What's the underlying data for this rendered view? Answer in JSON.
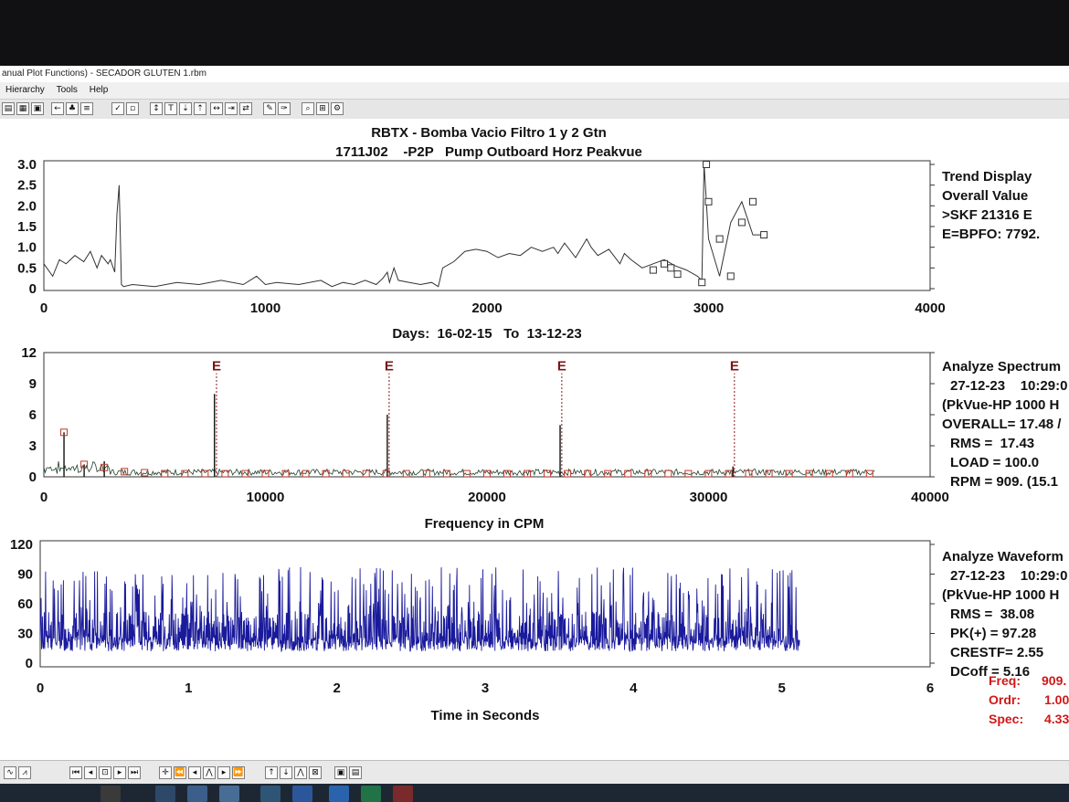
{
  "window": {
    "title": "anual Plot Functions) - SECADOR GLUTEN 1.rbm",
    "menu": [
      "Hierarchy",
      "Tools",
      "Help"
    ]
  },
  "header": {
    "title": "RBTX - Bomba Vacio Filtro 1 y 2 Gtn",
    "subtitle": "1711J02    -P2P   Pump Outboard Horz Peakvue"
  },
  "trend": {
    "info": [
      "Trend Display",
      "Overall Value",
      ">SKF 21316 E",
      "E=BPFO: 7792."
    ],
    "xlabel": "Days:  16-02-15   To  13-12-23"
  },
  "spectrum": {
    "marker_label": "E",
    "info": [
      "Analyze Spectrum",
      "27-12-23    10:29:0",
      "(PkVue-HP 1000 H",
      "OVERALL= 17.48 /",
      "RMS =  17.43",
      "LOAD = 100.0",
      "RPM = 909. (15.1"
    ],
    "xlabel": "Frequency in CPM"
  },
  "waveform": {
    "info": [
      "Analyze Waveform",
      "27-12-23    10:29:0",
      "(PkVue-HP 1000 H",
      "RMS =  38.08",
      "PK(+) = 97.28",
      "CRESTF= 2.55",
      "DCoff = 5.16"
    ],
    "xlabel": "Time in Seconds"
  },
  "cursor_readout": {
    "freq_label": "Freq:",
    "freq_value": "909.",
    "ordr_label": "Ordr:",
    "ordr_value": "1.00",
    "spec_label": "Spec:",
    "spec_value": "4.33"
  },
  "colors": {
    "trace_blue": "#1a1a9c",
    "marker_red": "#c0392b",
    "readout_red": "#d01818",
    "line": "#333333"
  },
  "chart_data": [
    {
      "type": "line",
      "name": "trend",
      "xlim": [
        0,
        4000
      ],
      "ylim": [
        0,
        3.0
      ],
      "x_ticks": [
        0,
        1000,
        2000,
        3000,
        4000
      ],
      "y_ticks": [
        0,
        0.5,
        1.0,
        1.5,
        2.0,
        2.5,
        3.0
      ],
      "y_tick_labels": [
        "0",
        "0.5",
        "1.0",
        "1.5",
        "2.0",
        "2.5",
        "3.0"
      ],
      "x": [
        0,
        40,
        70,
        100,
        140,
        180,
        210,
        240,
        260,
        290,
        300,
        320,
        330,
        340,
        350,
        360,
        400,
        500,
        600,
        700,
        800,
        900,
        960,
        1000,
        1050,
        1150,
        1250,
        1300,
        1350,
        1400,
        1450,
        1500,
        1530,
        1550,
        1560,
        1580,
        1600,
        1650,
        1700,
        1750,
        1780,
        1800,
        1850,
        1900,
        1950,
        2000,
        2050,
        2100,
        2150,
        2200,
        2250,
        2300,
        2320,
        2350,
        2400,
        2450,
        2470,
        2500,
        2550,
        2600,
        2620,
        2650,
        2700,
        2750,
        2800,
        2850,
        2900,
        2950,
        2970,
        2980,
        2990,
        3000,
        3050,
        3100,
        3150,
        3200,
        3250
      ],
      "y": [
        0.6,
        0.3,
        0.7,
        0.6,
        0.8,
        0.65,
        0.9,
        0.5,
        0.8,
        0.6,
        0.7,
        0.4,
        1.8,
        2.5,
        0.1,
        0.05,
        0.1,
        0.05,
        0.15,
        0.1,
        0.2,
        0.1,
        0.3,
        0.1,
        0.15,
        0.1,
        0.2,
        0.05,
        0.15,
        0.1,
        0.2,
        0.1,
        0.25,
        0.4,
        0.15,
        0.5,
        0.2,
        0.15,
        0.1,
        0.15,
        0.05,
        0.5,
        0.65,
        0.9,
        0.95,
        0.9,
        0.75,
        0.85,
        0.8,
        1.0,
        0.9,
        1.0,
        0.85,
        1.1,
        0.75,
        1.2,
        1.0,
        0.8,
        0.95,
        0.6,
        0.85,
        0.7,
        0.5,
        0.6,
        0.7,
        0.55,
        0.45,
        0.3,
        0.2,
        3.0,
        2.1,
        1.2,
        0.3,
        1.6,
        2.1,
        1.3,
        1.3
      ],
      "markers_x": [
        2750,
        2800,
        2830,
        2860,
        2970,
        2990,
        3000,
        3050,
        3100,
        3150,
        3200,
        3250
      ],
      "markers_y": [
        0.45,
        0.6,
        0.5,
        0.35,
        0.15,
        3.0,
        2.1,
        1.2,
        0.3,
        1.6,
        2.1,
        1.3
      ]
    },
    {
      "type": "line",
      "name": "spectrum",
      "xlim": [
        0,
        40000
      ],
      "ylim": [
        0,
        12
      ],
      "x_ticks": [
        0,
        10000,
        20000,
        30000,
        40000
      ],
      "y_ticks": [
        0,
        3,
        6,
        9,
        12
      ],
      "fault_markers_x": [
        7792,
        15584,
        23376,
        31168
      ],
      "peaks": [
        {
          "x": 909,
          "y": 4.3
        },
        {
          "x": 1818,
          "y": 1.2
        },
        {
          "x": 2727,
          "y": 1.5
        },
        {
          "x": 7700,
          "y": 8.0
        },
        {
          "x": 15500,
          "y": 6.0
        },
        {
          "x": 23300,
          "y": 5.0
        },
        {
          "x": 31100,
          "y": 1.0
        }
      ],
      "harmonic_boxes_x": [
        909,
        1818,
        2727,
        3636,
        4545,
        5454,
        6363,
        7272,
        8181,
        9090,
        9999,
        10908,
        11817,
        12726,
        13635,
        14544,
        15453,
        16362,
        17271,
        18180,
        19089,
        19998,
        20907,
        21816,
        22725,
        23634,
        24543,
        25452,
        26361,
        27270,
        28179,
        29088,
        29997,
        30906,
        31815,
        32724,
        33633,
        34542,
        35451,
        36360,
        37269
      ],
      "harmonic_boxes_y": [
        4.3,
        1.2,
        0.9,
        0.5,
        0.4,
        0.3,
        0.3,
        0.3,
        0.3,
        0.3,
        0.3,
        0.3,
        0.3,
        0.3,
        0.3,
        0.3,
        0.3,
        0.3,
        0.3,
        0.3,
        0.3,
        0.3,
        0.3,
        0.3,
        0.3,
        0.3,
        0.3,
        0.3,
        0.3,
        0.3,
        0.3,
        0.3,
        0.3,
        0.3,
        0.3,
        0.3,
        0.3,
        0.3,
        0.3,
        0.3,
        0.3
      ]
    },
    {
      "type": "line",
      "name": "waveform",
      "xlim": [
        0,
        6
      ],
      "ylim": [
        0,
        120
      ],
      "x_ticks": [
        0,
        1,
        2,
        3,
        4,
        5,
        6
      ],
      "y_ticks": [
        0,
        30,
        60,
        90,
        120
      ],
      "duration": 5.12,
      "baseline": 12,
      "noise_amplitude": 45,
      "peak_max": 97.28
    }
  ]
}
